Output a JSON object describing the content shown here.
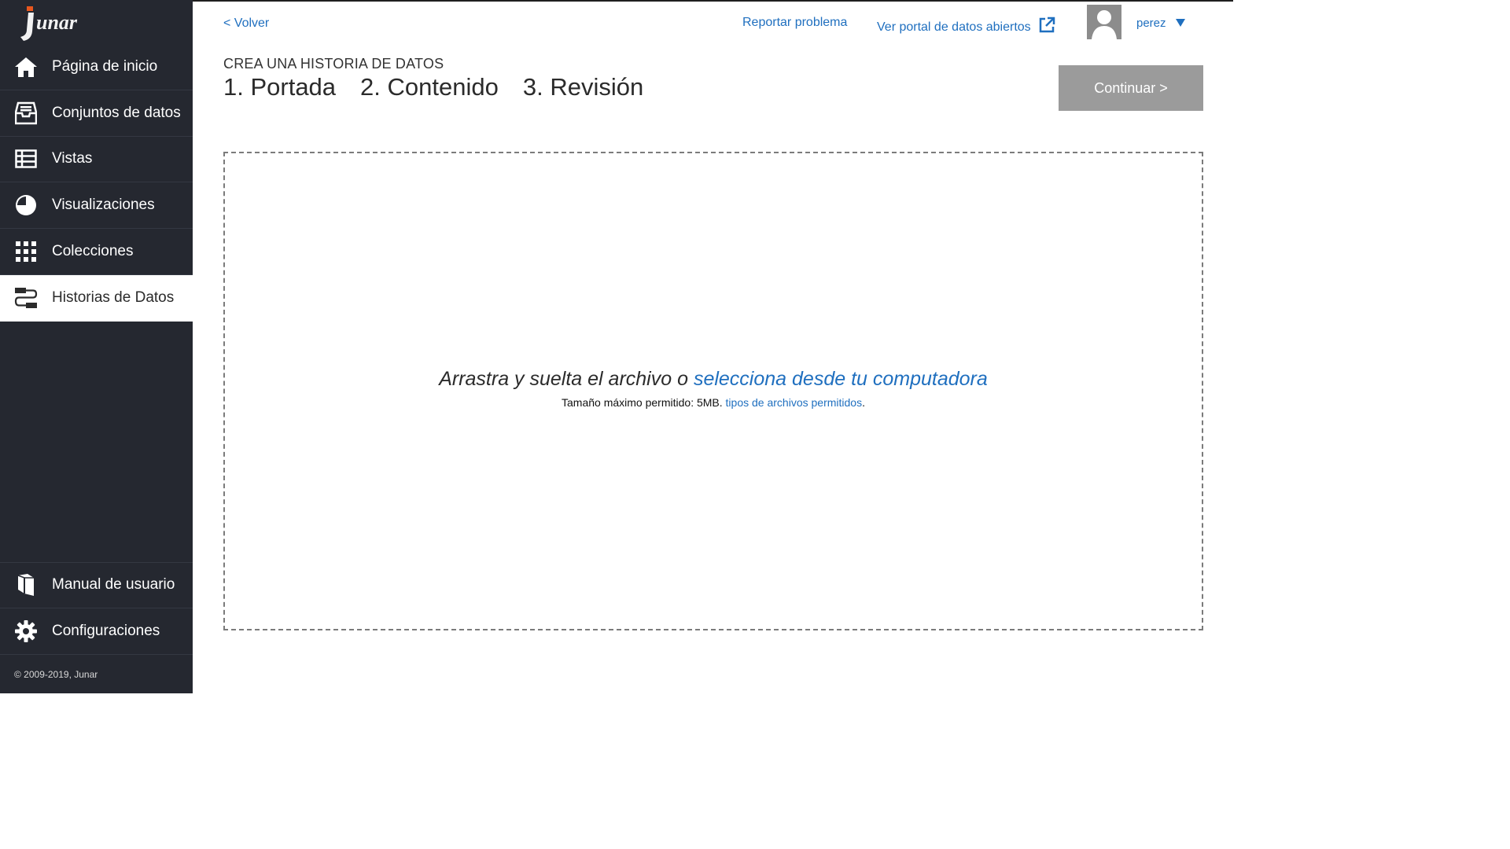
{
  "sidebar": {
    "logo_text": "junar",
    "items": [
      {
        "label": "Página de inicio",
        "icon": "home-icon"
      },
      {
        "label": "Conjuntos de datos",
        "icon": "inbox-icon"
      },
      {
        "label": "Vistas",
        "icon": "table-icon"
      },
      {
        "label": "Visualizaciones",
        "icon": "pie-chart-icon"
      },
      {
        "label": "Colecciones",
        "icon": "grid-icon"
      },
      {
        "label": "Historias de Datos",
        "icon": "data-story-icon",
        "active": true
      }
    ],
    "bottom_items": [
      {
        "label": "Manual de usuario",
        "icon": "book-icon"
      },
      {
        "label": "Configuraciones",
        "icon": "gear-icon"
      }
    ],
    "copyright": "© 2009-2019, Junar"
  },
  "header": {
    "back_label": "< Volver",
    "report_label": "Reportar problema",
    "portal_label": "Ver portal de datos abiertos",
    "username": "perez"
  },
  "wizard": {
    "subtitle": "CREA UNA HISTORIA DE DATOS",
    "steps": [
      "1. Portada",
      "2. Contenido",
      "3. Revisión"
    ],
    "continue_label": "Continuar >"
  },
  "dropzone": {
    "main_text": "Arrastra y suelta el archivo o",
    "select_link": "selecciona desde tu computadora",
    "size_text": "Tamaño máximo permitido: 5MB.",
    "types_link": "tipos de archivos permitidos",
    "period": "."
  },
  "colors": {
    "sidebar_bg": "#252830",
    "link": "#1f6fbf",
    "button_disabled": "#9b9b9b",
    "logo_accent": "#e8571e"
  }
}
